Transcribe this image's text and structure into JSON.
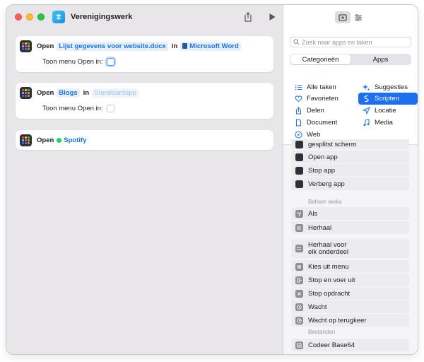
{
  "window": {
    "title": "Verenigingswerk"
  },
  "actions": [
    {
      "verb": "Open",
      "target": "Lijst gegevens voor website.docx",
      "connector": "in",
      "app": "Microsoft Word",
      "option_label": "Toon menu Open in:"
    },
    {
      "verb": "Open",
      "target": "Blogs",
      "connector": "in",
      "app": "Standaardapp",
      "option_label": "Toon menu Open in:"
    },
    {
      "verb": "Open",
      "target": "Spotify"
    }
  ],
  "sidebar": {
    "search_placeholder": "Zoek naar apps en taken",
    "segments": [
      "Categorieën",
      "Apps"
    ],
    "active_segment": "Categorieën",
    "categories_left": [
      "Alle taken",
      "Favorieten",
      "Delen",
      "Document",
      "Web"
    ],
    "categories_right": [
      "Suggesties",
      "Scripten",
      "Locatie",
      "Media"
    ],
    "active_category": "Scripten",
    "items_top": [
      "gesplitst scherm",
      "Open app",
      "Stop app",
      "Verberg app"
    ],
    "section_control": "Beheer reeks",
    "items_control": [
      "Als",
      "Herhaal",
      "Herhaal voor\nelk onderdeel",
      "Kies uit menu",
      "Stop en voer uit",
      "Stop opdracht",
      "Wacht",
      "Wacht op terugkeer"
    ],
    "section_files": "Bestanden",
    "items_files": [
      "Codeer Base64"
    ]
  },
  "colors": {
    "accent": "#1e6ff0",
    "token_text": "#1a73e8",
    "spotify_green": "#1ed760",
    "word_blue": "#2b579a"
  }
}
